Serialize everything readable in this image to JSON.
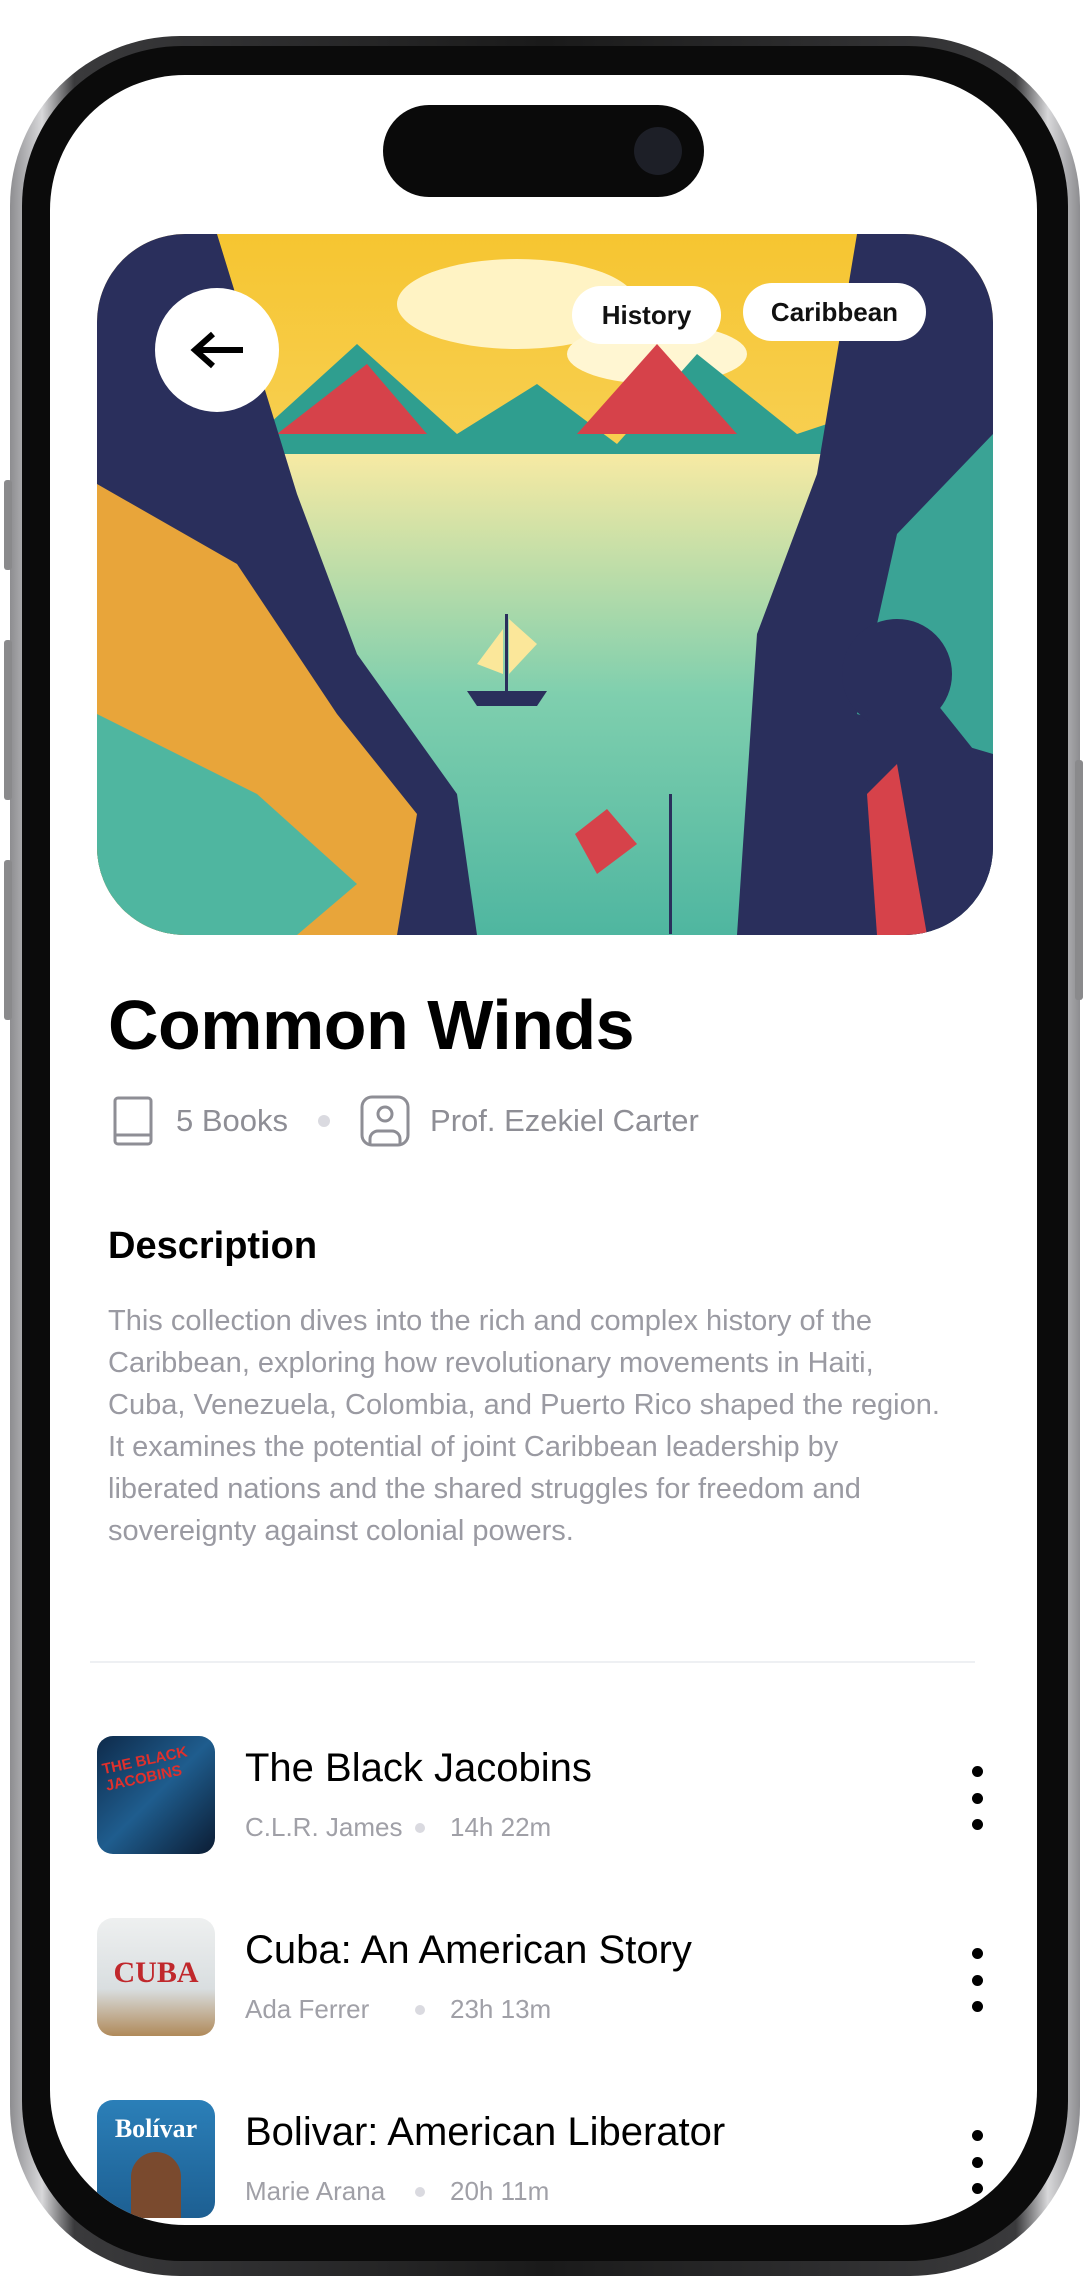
{
  "hero": {
    "back_icon": "arrow-left-icon",
    "tags": [
      "History",
      "Caribbean"
    ]
  },
  "collection": {
    "title": "Common Winds",
    "books_count": "5 Books",
    "author": "Prof. Ezekiel Carter"
  },
  "description": {
    "heading": "Description",
    "text": "This collection dives into the rich and complex history of the Caribbean, exploring how revolutionary movements in Haiti, Cuba, Venezuela, Colombia, and Puerto Rico shaped the region. It examines the potential of joint Caribbean leadership by liberated nations and the shared struggles for freedom and sovereignty against colonial powers."
  },
  "books": [
    {
      "title": "The Black Jacobins",
      "author": "C.L.R. James",
      "duration": "14h 22m",
      "cover_text": "THE BLACK JACOBINS"
    },
    {
      "title": "Cuba: An American Story",
      "author": "Ada Ferrer",
      "duration": "23h 13m",
      "cover_text": "CUBA"
    },
    {
      "title": "Bolivar: American Liberator",
      "author": "Marie Arana",
      "duration": "20h 11m",
      "cover_text": "Bolívar"
    }
  ]
}
